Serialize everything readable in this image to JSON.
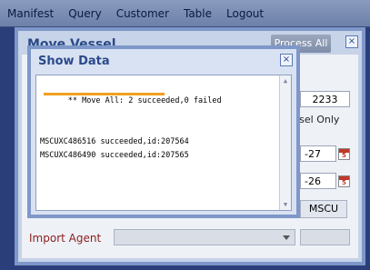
{
  "menu": [
    "Manifest",
    "Query",
    "Customer",
    "Table",
    "Logout"
  ],
  "outer_dialog": {
    "title": "Move Vessel",
    "close": "×",
    "process_button": "Process All",
    "number_value": "2233",
    "vessel_only_label": "Vessel Only",
    "date_fragment_1": "-27",
    "date_fragment_2": "-26",
    "code_value": "MSCU",
    "import_agent_label": "Import Agent",
    "calendar_icon_glyph": "5"
  },
  "show_data": {
    "title": "Show Data",
    "close": "×",
    "lines": [
      "** Move All: 2 succeeded,0 failed",
      "MSCUXC486516 succeeded,id:207564",
      "MSCUXC486490 succeeded,id:207565"
    ],
    "highlight_color": "#f0a020"
  }
}
